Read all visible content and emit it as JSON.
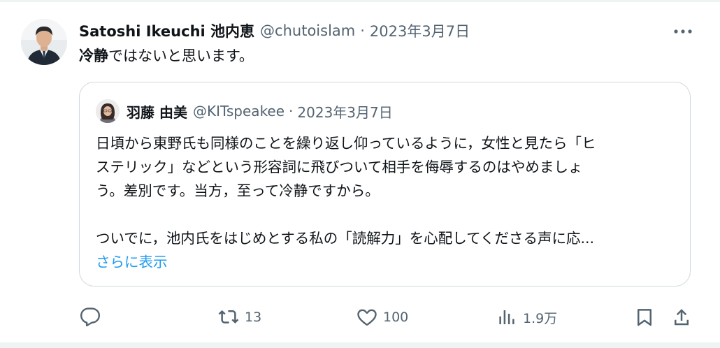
{
  "tweet": {
    "author_name": "Satoshi Ikeuchi 池内恵",
    "handle": "@chutoislam",
    "separator": "·",
    "date": "2023年3月7日",
    "text_bold": "冷静",
    "text_rest": "ではないと思います。",
    "avatar": "profile-photo"
  },
  "quote": {
    "author_name": "羽藤 由美",
    "handle": "@KITspeakee",
    "separator": "·",
    "date": "2023年3月7日",
    "lines": [
      "日頃から東野氏も同様のことを繰り返し仰っているように，女性と見たら「ヒ",
      "ステリック」などという形容詞に飛びついて相手を侮辱するのはやめましょ",
      "う。差別です。当方，至って冷静ですから。",
      "",
      "ついでに，池内氏をはじめとする私の「読解力」を心配してくださる声に応..."
    ],
    "show_more": "さらに表示"
  },
  "actions": {
    "reply": {
      "icon": "reply-icon",
      "count": ""
    },
    "retweet": {
      "icon": "retweet-icon",
      "count": "13"
    },
    "like": {
      "icon": "heart-icon",
      "count": "100"
    },
    "views": {
      "icon": "views-chart-icon",
      "count": "1.9万"
    },
    "bookmark": {
      "icon": "bookmark-icon"
    },
    "share": {
      "icon": "share-icon"
    }
  },
  "colors": {
    "text_primary": "#0f1419",
    "text_secondary": "#536471",
    "link": "#1d9bf0",
    "border": "#cfd9de"
  }
}
